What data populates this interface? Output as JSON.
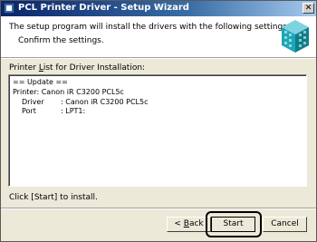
{
  "window": {
    "title": "PCL Printer Driver - Setup Wizard",
    "close_glyph": "✕"
  },
  "header": {
    "line1": "The setup program will install the drivers with the following settings.",
    "line2": "Confirm the settings.",
    "icon": "printer-cube-icon"
  },
  "printer_list": {
    "label_pre": "Printer ",
    "label_hotkey": "L",
    "label_post": "ist for Driver Installation:",
    "lines": [
      "== Update ==",
      "Printer: Canon iR C3200 PCL5c",
      "Driver",
      "Port"
    ],
    "driver_value": ": Canon iR C3200 PCL5c",
    "port_value": ": LPT1:"
  },
  "footer": {
    "instruction": "Click [Start] to install."
  },
  "buttons": {
    "back_pre": "< ",
    "back_hotkey": "B",
    "back_post": "ack",
    "start": "Start",
    "cancel": "Cancel"
  },
  "colors": {
    "titlebar_start": "#0a246a",
    "titlebar_end": "#a6caf0",
    "dialog_bg": "#ece9d8",
    "icon_cyan": "#1aa7b8"
  }
}
